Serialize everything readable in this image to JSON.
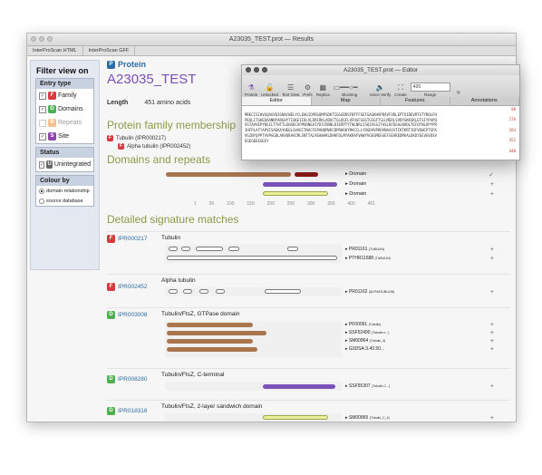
{
  "window": {
    "title": "A23035_TEST.prot — Results",
    "tabs": [
      "InterProScan HTML",
      "InterProScan GFF"
    ]
  },
  "sidebar": {
    "title": "Filter view on",
    "entry_type": {
      "header": "Entry type",
      "items": [
        {
          "badge": "F",
          "label": "Family",
          "color": "#d9383f"
        },
        {
          "badge": "D",
          "label": "Domains",
          "color": "#4caf50"
        },
        {
          "badge": "R",
          "label": "Repeats",
          "color": "#f0a34a"
        },
        {
          "badge": "S",
          "label": "Site",
          "color": "#8e44ad"
        }
      ]
    },
    "status": {
      "header": "Status",
      "item": {
        "badge": "U",
        "label": "Unintegrated",
        "color": "#666666"
      }
    },
    "colour_by": {
      "header": "Colour by",
      "options": [
        "domain relationship",
        "source database"
      ]
    }
  },
  "main": {
    "protein_label": "Protein",
    "protein_name": "A23035_TEST",
    "length_label": "Length",
    "length_value": "451 amino acids",
    "family_title": "Protein family membership",
    "families": [
      "Tubulin (IPR000217)",
      "Alpha tubulin (IPR002452)"
    ],
    "domains_title": "Domains and repeats",
    "domain_tracks": [
      {
        "label": "Domain",
        "color": "#8a4a2c",
        "accent": "#8b1a1a",
        "mark": "✓"
      },
      {
        "label": "Domain",
        "color": "#7b52b7",
        "mark": "+"
      },
      {
        "label": "Domain",
        "color": "#d9de7a",
        "mark": "+"
      }
    ],
    "axis_ticks": [
      "1",
      "50",
      "100",
      "150",
      "200",
      "250",
      "300",
      "350",
      "400",
      "451"
    ],
    "matches_title": "Detailed signature matches",
    "matches": [
      {
        "id": "IPR000217",
        "name": "Tubulin",
        "color": "#d9383f",
        "refs": [
          "PR01161",
          "PTHR11588"
        ],
        "ref_tags": [
          "(TUBULIN)",
          "(TUBULIN)"
        ]
      },
      {
        "id": "IPR002452",
        "name": "Alpha tubulin",
        "color": "#d9383f",
        "refs": [
          "PR01162"
        ],
        "ref_tags": [
          "(ALPHATUBULIN)"
        ]
      },
      {
        "id": "IPR003008",
        "name": "Tubulin/FtsZ, GTPase domain",
        "color": "#4caf50",
        "refs": [
          "PF00091",
          "SSF52490",
          "SM00864",
          "G3DSA:3.40.50..."
        ],
        "ref_tags": [
          "(Tubulin)",
          "(Tubulin n...)",
          "(Tubulin_4)",
          ""
        ]
      },
      {
        "id": "IPR008280",
        "name": "Tubulin/FtsZ, C-terminal",
        "color": "#4caf50",
        "refs": [
          "SSF55307"
        ],
        "ref_tags": [
          "(Tubulin C...)"
        ]
      },
      {
        "id": "IPR018316",
        "name": "Tubulin/FtsZ, 2-layer sandwich domain",
        "color": "#4caf50",
        "refs": [
          "SM00865"
        ],
        "ref_tags": [
          "(Tubulin_C_4)"
        ]
      }
    ]
  },
  "editor": {
    "title": "A23035_TEST.prot — Editor",
    "toolbar": [
      "Protein",
      "Unlocked",
      "Text View",
      "Prefs",
      "Replica",
      "Blocking",
      "Voice Verify",
      "Create"
    ],
    "range_value": "420",
    "range_label": "Range",
    "tabs": [
      "Editor",
      "Map",
      "Features",
      "Annotations"
    ],
    "seq_numbers": [
      "88",
      "176",
      "264",
      "352",
      "440"
    ],
    "sequence": [
      "MRECISIHVGQAGVQIGNACWELYCLEHGIQPDGQMPSDKTIGGGDDSFNTFFSETGAGKHVPRAVFVDLEPTVIDEVRTGTYRQLFH",
      "PEQLITGKEDAANNYARGHYTIGKEIIDLVLDRIRKLADQCTGLQGFLVFHSFGGGTGSGFTSLLMERLSVDYGKKSKLEFSIYPAPQ",
      "VSTAVVEPYNSILTTHTTLEHSDCAFMVDNEAIYDICRRNLDIERPTYTNLNRLISQIVSSITASLRFDGALNVDLTEFQTNLVPYPR",
      "IHFPLATYAPVISAEKAYHEQLSVAEITNACFEPANQMVKCDPRHGKYMACCLLYRGDVVPKDVNAAIATIKTKRTIQFVDWCPTGFK",
      "VGINYQPPTVVPGGDLAKVQRAVCMLSNTTAIAEAWARLDHKFDLMYAKRAFVHWYVGEGMEEGEFSEAREDMAALEKDYEEVGVDSV",
      "EGEGEEEGEEY"
    ]
  }
}
